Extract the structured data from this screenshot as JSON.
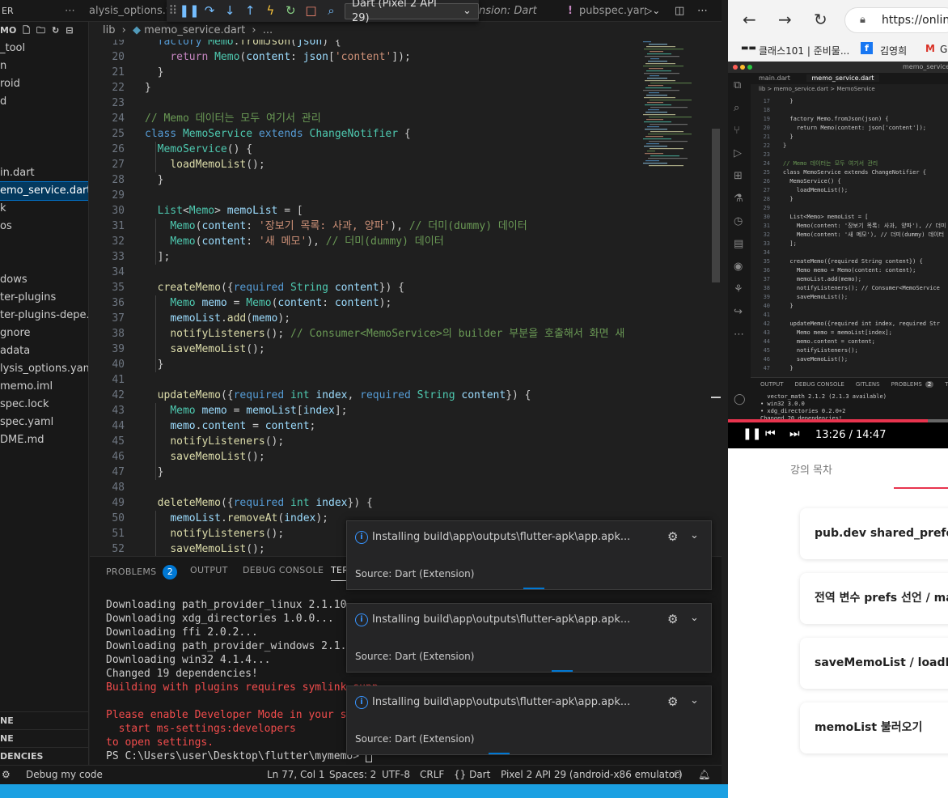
{
  "vscode": {
    "tabs": [
      "alysis_options.y",
      "nsion: Dart",
      "pubspec.yar"
    ],
    "debug": {
      "device": "Dart (Pixel 2 API 29)"
    },
    "breadcrumb": {
      "folder": "lib",
      "file": "memo_service.dart",
      "more": "..."
    },
    "explorer": {
      "title": "ER",
      "section": "MO",
      "items": [
        "_tool",
        "n",
        "roid",
        "d",
        "",
        "",
        "",
        "in.dart",
        "emo_service.dart",
        "k",
        "os",
        "",
        "",
        "dows",
        "ter-plugins",
        "ter-plugins-depe...",
        "gnore",
        "adata",
        "lysis_options.yaml",
        "memo.iml",
        "spec.lock",
        "spec.yaml",
        "DME.md"
      ],
      "sections": [
        "NE",
        "NE",
        "DENCIES"
      ]
    },
    "code": [
      {
        "n": "19",
        "segs": [
          [
            "  ",
            ""
          ],
          [
            "factory ",
            "kw"
          ],
          [
            "Memo",
            "ty"
          ],
          [
            ".",
            ""
          ],
          [
            "fromJson",
            "fn"
          ],
          [
            "(",
            ""
          ],
          [
            "json",
            "pr"
          ],
          [
            ") {",
            ""
          ]
        ]
      },
      {
        "n": "20",
        "segs": [
          [
            "    ",
            ""
          ],
          [
            "return ",
            "ctl"
          ],
          [
            "Memo",
            "ty"
          ],
          [
            "(",
            ""
          ],
          [
            "content",
            "pr"
          ],
          [
            ": ",
            ""
          ],
          [
            "json",
            "pr"
          ],
          [
            "[",
            ""
          ],
          [
            "'content'",
            "st"
          ],
          [
            "]);",
            ""
          ]
        ]
      },
      {
        "n": "21",
        "segs": [
          [
            "  }",
            ""
          ]
        ]
      },
      {
        "n": "22",
        "segs": [
          [
            "}",
            ""
          ]
        ]
      },
      {
        "n": "23",
        "segs": []
      },
      {
        "n": "24",
        "segs": [
          [
            "// Memo 데이터는 모두 여기서 관리",
            "cm"
          ]
        ]
      },
      {
        "n": "25",
        "segs": [
          [
            "class ",
            "kw"
          ],
          [
            "MemoService ",
            "ty"
          ],
          [
            "extends ",
            "kw"
          ],
          [
            "ChangeNotifier ",
            "ty"
          ],
          [
            "{",
            ""
          ]
        ]
      },
      {
        "n": "26",
        "segs": [
          [
            "  ",
            ""
          ],
          [
            "MemoService",
            "ty"
          ],
          [
            "() {",
            ""
          ]
        ]
      },
      {
        "n": "27",
        "segs": [
          [
            "    ",
            ""
          ],
          [
            "loadMemoList",
            "fn"
          ],
          [
            "();",
            ""
          ]
        ]
      },
      {
        "n": "28",
        "segs": [
          [
            "  }",
            ""
          ]
        ]
      },
      {
        "n": "29",
        "segs": []
      },
      {
        "n": "30",
        "segs": [
          [
            "  ",
            ""
          ],
          [
            "List",
            "ty"
          ],
          [
            "<",
            ""
          ],
          [
            "Memo",
            "ty"
          ],
          [
            "> ",
            ""
          ],
          [
            "memoList",
            "pr"
          ],
          [
            " = [",
            ""
          ]
        ]
      },
      {
        "n": "31",
        "segs": [
          [
            "    ",
            ""
          ],
          [
            "Memo",
            "ty"
          ],
          [
            "(",
            ""
          ],
          [
            "content",
            "pr"
          ],
          [
            ": ",
            ""
          ],
          [
            "'장보기 목록: 사과, 양파'",
            "st"
          ],
          [
            "), ",
            ""
          ],
          [
            "// 더미(dummy) 데이터",
            "cm"
          ]
        ]
      },
      {
        "n": "32",
        "segs": [
          [
            "    ",
            ""
          ],
          [
            "Memo",
            "ty"
          ],
          [
            "(",
            ""
          ],
          [
            "content",
            "pr"
          ],
          [
            ": ",
            ""
          ],
          [
            "'새 메모'",
            "st"
          ],
          [
            "), ",
            ""
          ],
          [
            "// 더미(dummy) 데이터",
            "cm"
          ]
        ]
      },
      {
        "n": "33",
        "segs": [
          [
            "  ];",
            ""
          ]
        ]
      },
      {
        "n": "34",
        "segs": []
      },
      {
        "n": "35",
        "segs": [
          [
            "  ",
            ""
          ],
          [
            "createMemo",
            "fn"
          ],
          [
            "({",
            ""
          ],
          [
            "required ",
            "kw"
          ],
          [
            "String ",
            "ty"
          ],
          [
            "content",
            "pr"
          ],
          [
            "}) {",
            ""
          ]
        ]
      },
      {
        "n": "36",
        "segs": [
          [
            "    ",
            ""
          ],
          [
            "Memo ",
            "ty"
          ],
          [
            "memo",
            "pr"
          ],
          [
            " = ",
            ""
          ],
          [
            "Memo",
            "ty"
          ],
          [
            "(",
            ""
          ],
          [
            "content",
            "pr"
          ],
          [
            ": ",
            ""
          ],
          [
            "content",
            "pr"
          ],
          [
            ");",
            ""
          ]
        ]
      },
      {
        "n": "37",
        "segs": [
          [
            "    ",
            ""
          ],
          [
            "memoList",
            "pr"
          ],
          [
            ".",
            ""
          ],
          [
            "add",
            "fn"
          ],
          [
            "(",
            ""
          ],
          [
            "memo",
            "pr"
          ],
          [
            ");",
            ""
          ]
        ]
      },
      {
        "n": "38",
        "segs": [
          [
            "    ",
            ""
          ],
          [
            "notifyListeners",
            "fn"
          ],
          [
            "(); ",
            ""
          ],
          [
            "// Consumer<MemoService>의 builder 부분을 호출해서 화면 새",
            "cm"
          ]
        ]
      },
      {
        "n": "39",
        "segs": [
          [
            "    ",
            ""
          ],
          [
            "saveMemoList",
            "fn"
          ],
          [
            "();",
            ""
          ]
        ]
      },
      {
        "n": "40",
        "segs": [
          [
            "  }",
            ""
          ]
        ]
      },
      {
        "n": "41",
        "segs": []
      },
      {
        "n": "42",
        "segs": [
          [
            "  ",
            ""
          ],
          [
            "updateMemo",
            "fn"
          ],
          [
            "({",
            ""
          ],
          [
            "required ",
            "kw"
          ],
          [
            "int ",
            "ty"
          ],
          [
            "index",
            "pr"
          ],
          [
            ", ",
            ""
          ],
          [
            "required ",
            "kw"
          ],
          [
            "String ",
            "ty"
          ],
          [
            "content",
            "pr"
          ],
          [
            "}) {",
            ""
          ]
        ]
      },
      {
        "n": "43",
        "segs": [
          [
            "    ",
            ""
          ],
          [
            "Memo ",
            "ty"
          ],
          [
            "memo",
            "pr"
          ],
          [
            " = ",
            ""
          ],
          [
            "memoList",
            "pr"
          ],
          [
            "[",
            ""
          ],
          [
            "index",
            "pr"
          ],
          [
            "];",
            ""
          ]
        ]
      },
      {
        "n": "44",
        "segs": [
          [
            "    ",
            ""
          ],
          [
            "memo",
            "pr"
          ],
          [
            ".",
            ""
          ],
          [
            "content",
            "pr"
          ],
          [
            " = ",
            ""
          ],
          [
            "content",
            "pr"
          ],
          [
            ";",
            ""
          ]
        ]
      },
      {
        "n": "45",
        "segs": [
          [
            "    ",
            ""
          ],
          [
            "notifyListeners",
            "fn"
          ],
          [
            "();",
            ""
          ]
        ]
      },
      {
        "n": "46",
        "segs": [
          [
            "    ",
            ""
          ],
          [
            "saveMemoList",
            "fn"
          ],
          [
            "();",
            ""
          ]
        ]
      },
      {
        "n": "47",
        "segs": [
          [
            "  }",
            ""
          ]
        ]
      },
      {
        "n": "48",
        "segs": []
      },
      {
        "n": "49",
        "segs": [
          [
            "  ",
            ""
          ],
          [
            "deleteMemo",
            "fn"
          ],
          [
            "({",
            ""
          ],
          [
            "required ",
            "kw"
          ],
          [
            "int ",
            "ty"
          ],
          [
            "index",
            "pr"
          ],
          [
            "}) {",
            ""
          ]
        ]
      },
      {
        "n": "50",
        "segs": [
          [
            "    ",
            ""
          ],
          [
            "memoList",
            "pr"
          ],
          [
            ".",
            ""
          ],
          [
            "removeAt",
            "fn"
          ],
          [
            "(",
            ""
          ],
          [
            "index",
            "pr"
          ],
          [
            ");",
            ""
          ]
        ]
      },
      {
        "n": "51",
        "segs": [
          [
            "    ",
            ""
          ],
          [
            "notifyListeners",
            "fn"
          ],
          [
            "();",
            ""
          ]
        ]
      },
      {
        "n": "52",
        "segs": [
          [
            "    ",
            ""
          ],
          [
            "saveMemoList",
            "fn"
          ],
          [
            "();",
            ""
          ]
        ]
      }
    ],
    "panel": {
      "tabs": [
        "PROBLEMS",
        "OUTPUT",
        "DEBUG CONSOLE",
        "TER"
      ],
      "problems_count": "2",
      "lines": [
        {
          "t": "Downloading path_provider_linux 2.1.10...",
          "c": ""
        },
        {
          "t": "Downloading xdg_directories 1.0.0...",
          "c": ""
        },
        {
          "t": "Downloading ffi 2.0.2...",
          "c": ""
        },
        {
          "t": "Downloading path_provider_windows 2.1.6...",
          "c": ""
        },
        {
          "t": "Downloading win32 4.1.4...",
          "c": ""
        },
        {
          "t": "Changed 19 dependencies!",
          "c": ""
        },
        {
          "t": "Building with plugins requires symlink supp",
          "c": "red"
        },
        {
          "t": "",
          "c": ""
        },
        {
          "t": "Please enable Developer Mode in your system",
          "c": "red"
        },
        {
          "t": "  start ms-settings:developers",
          "c": "red"
        },
        {
          "t": "to open settings.",
          "c": "red"
        },
        {
          "t": "PS C:\\Users\\user\\Desktop\\flutter\\mymemo> ",
          "c": ""
        }
      ]
    },
    "toasts": [
      {
        "msg": "Installing build\\app\\outputs\\flutter-apk\\app.apk...",
        "source": "Source: Dart (Extension)"
      },
      {
        "msg": "Installing build\\app\\outputs\\flutter-apk\\app.apk...",
        "source": "Source: Dart (Extension)"
      },
      {
        "msg": "Installing build\\app\\outputs\\flutter-apk\\app.apk...",
        "source": "Source: Dart (Extension)"
      }
    ],
    "status": {
      "debug": "Debug my code",
      "position": "Ln 77, Col 1",
      "spaces": "Spaces: 2",
      "encoding": "UTF-8",
      "eol": "CRLF",
      "language": "{} Dart",
      "device": "Pixel 2 API 29 (android-x86 emulator)"
    }
  },
  "browser": {
    "url": "https://onlin",
    "bookmarks": [
      "클래스101 | 준비물...",
      "김영희",
      "G"
    ],
    "video": {
      "title": "memo_service.d",
      "tabs": [
        "main.dart",
        "memo_service.dart"
      ],
      "crumb": "lib > memo_service.dart > MemoService",
      "lines": [
        [
          "17",
          "  }"
        ],
        [
          "18",
          ""
        ],
        [
          "19",
          "  factory Memo.fromJson(json) {"
        ],
        [
          "20",
          "    return Memo(content: json['content']);"
        ],
        [
          "21",
          "  }"
        ],
        [
          "22",
          "}"
        ],
        [
          "23",
          ""
        ],
        [
          "24",
          "// Memo 데이터는 모두 여기서 관리"
        ],
        [
          "25",
          "class MemoService extends ChangeNotifier {"
        ],
        [
          "26",
          "  MemoService() {"
        ],
        [
          "27",
          "    loadMemoList();"
        ],
        [
          "28",
          "  }"
        ],
        [
          "29",
          ""
        ],
        [
          "30",
          "  List<Memo> memoList = ["
        ],
        [
          "31",
          "    Memo(content: '장보기 목록: 사과, 양파'), // 더미"
        ],
        [
          "32",
          "    Memo(content: '새 메모'), // 더미(dummy) 데이터"
        ],
        [
          "33",
          "  ];"
        ],
        [
          "34",
          ""
        ],
        [
          "35",
          "  createMemo({required String content}) {"
        ],
        [
          "36",
          "    Memo memo = Memo(content: content);"
        ],
        [
          "37",
          "    memoList.add(memo);"
        ],
        [
          "38",
          "    notifyListeners(); // Consumer<MemoService"
        ],
        [
          "39",
          "    saveMemoList();"
        ],
        [
          "40",
          "  }"
        ],
        [
          "41",
          ""
        ],
        [
          "42",
          "  updateMemo({required int index, required Str"
        ],
        [
          "43",
          "    Memo memo = memoList[index];"
        ],
        [
          "44",
          "    memo.content = content;"
        ],
        [
          "45",
          "    notifyListeners();"
        ],
        [
          "46",
          "    saveMemoList();"
        ],
        [
          "47",
          "  }"
        ]
      ],
      "panel_tabs": [
        "OUTPUT",
        "DEBUG CONSOLE",
        "GITLENS",
        "PROBLEMS",
        "TE"
      ],
      "panel_count": "2",
      "term": [
        "  vector_math 2.1.2 (2.1.3 available)",
        "• win32 3.0.0",
        "• xdg_directories 0.2.0+2",
        "Changed 20 dependencies!"
      ],
      "time_current": "13:26 /",
      "time_total": "14:47",
      "progress": 0.907
    },
    "course_tab": "강의 목차",
    "lessons": [
      "pub.dev shared_prefe",
      "전역 변수 prefs 선언 / ma",
      "saveMemoList / loadM",
      "memoList 불러오기"
    ]
  }
}
